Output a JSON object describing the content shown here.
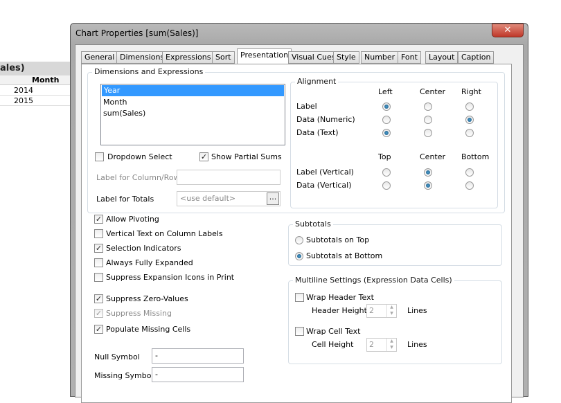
{
  "background": {
    "title": "ales)",
    "column": "Month",
    "rows": [
      "2014",
      "2015"
    ]
  },
  "dialog": {
    "title": "Chart Properties [sum(Sales)]",
    "close_icon": "close-icon",
    "tabs": [
      "General",
      "Dimensions",
      "Expressions",
      "Sort",
      "Presentation",
      "Visual Cues",
      "Style",
      "Number",
      "Font",
      "Layout",
      "Caption"
    ],
    "active_tab": "Presentation"
  },
  "dims": {
    "legend": "Dimensions and Expressions",
    "items": [
      "Year",
      "Month",
      "sum(Sales)"
    ],
    "selected": "Year",
    "dropdown_select": "Dropdown Select",
    "show_partial_sums": "Show Partial Sums",
    "label_col_row": "Label for Column/Row",
    "label_totals": "Label for Totals",
    "totals_placeholder": "<use default>",
    "browse": "..."
  },
  "alignment": {
    "legend": "Alignment",
    "cols": [
      "Left",
      "Center",
      "Right"
    ],
    "vcols": [
      "Top",
      "Center",
      "Bottom"
    ],
    "rows": [
      {
        "label": "Label",
        "sel": 0
      },
      {
        "label": "Data (Numeric)",
        "sel": 2
      },
      {
        "label": "Data (Text)",
        "sel": 0
      }
    ],
    "vrows": [
      {
        "label": "Label (Vertical)",
        "sel": 1
      },
      {
        "label": "Data (Vertical)",
        "sel": 1
      }
    ]
  },
  "options": [
    {
      "label": "Allow Pivoting",
      "checked": true
    },
    {
      "label": "Vertical Text on Column Labels",
      "checked": false
    },
    {
      "label": "Selection Indicators",
      "checked": true
    },
    {
      "label": "Always Fully Expanded",
      "checked": false
    },
    {
      "label": "Suppress Expansion Icons in Print",
      "checked": false
    },
    {
      "label": "Suppress Zero-Values",
      "checked": true
    },
    {
      "label": "Suppress Missing",
      "checked": true,
      "disabled": true
    },
    {
      "label": "Populate Missing Cells",
      "checked": true
    }
  ],
  "null_symbol": {
    "label": "Null Symbol",
    "value": "-"
  },
  "missing_symbol": {
    "label": "Missing Symbol",
    "value": "-"
  },
  "subtotals": {
    "legend": "Subtotals",
    "top": "Subtotals on Top",
    "bottom": "Subtotals at Bottom",
    "selected": "bottom"
  },
  "multiline": {
    "legend": "Multiline Settings (Expression Data Cells)",
    "wrap_header": "Wrap Header Text",
    "header_height": "Header Height",
    "header_value": "2",
    "wrap_cell": "Wrap Cell Text",
    "cell_height": "Cell Height",
    "cell_value": "2",
    "lines": "Lines"
  }
}
